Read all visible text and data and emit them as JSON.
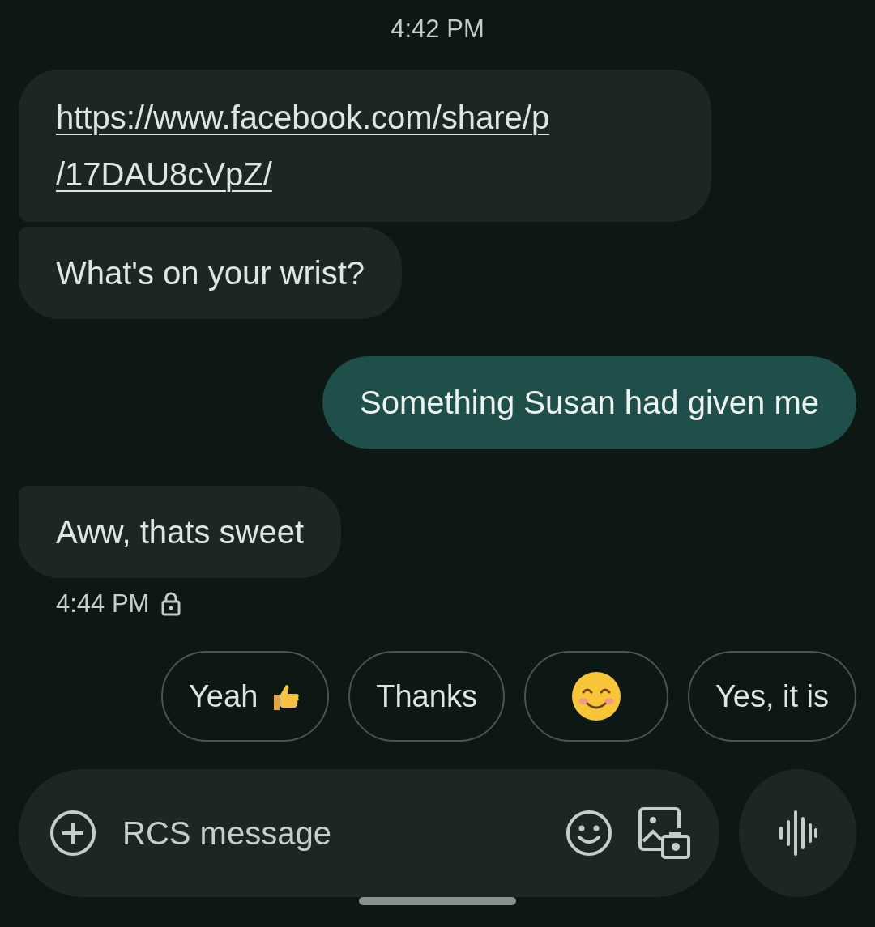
{
  "top_time": "4:42 PM",
  "messages": [
    {
      "sent": false,
      "kind": "link",
      "text": "https://www.facebook.com/share/p\n/17DAU8cVpZ/"
    },
    {
      "sent": false,
      "kind": "text",
      "text": "What's on your wrist?"
    },
    {
      "sent": true,
      "kind": "text",
      "text": "Something Susan had given me"
    },
    {
      "sent": false,
      "kind": "text",
      "text": "Aww, thats sweet"
    }
  ],
  "status": {
    "time": "4:44 PM",
    "encrypted": true
  },
  "suggestions": [
    {
      "kind": "label_thumb",
      "label": "Yeah"
    },
    {
      "kind": "label",
      "label": "Thanks"
    },
    {
      "kind": "smiley"
    },
    {
      "kind": "label",
      "label": "Yes, it is"
    }
  ],
  "compose": {
    "placeholder": "RCS message"
  }
}
